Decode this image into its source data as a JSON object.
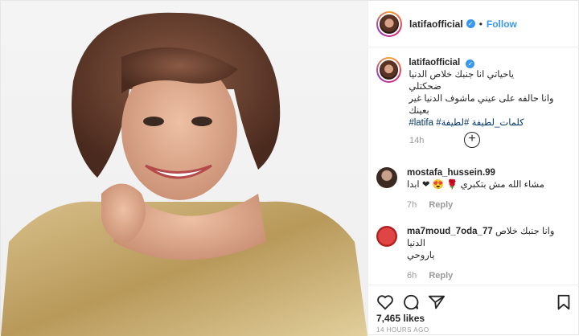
{
  "post": {
    "username": "latifaofficial",
    "follow_label": "Follow",
    "dot": "•",
    "caption_user": "latifaofficial",
    "caption_lines": [
      "ياحياتي انا جنبك خلاص الدنيا",
      "ضحكتلي",
      "وانا حالفه على عيني ماشوف الدنيا غير بعينك"
    ],
    "caption_tags": "#latifa #كلمات_لطيفة #لطيفة",
    "caption_time": "14h",
    "likes": "7,465 likes",
    "posted": "14 HOURS AGO"
  },
  "comments": [
    {
      "user": "mostafa_hussein.99",
      "text": "مشاء الله مش بتكبري 🌹 😍 ❤ ابدا",
      "time": "7h",
      "reply": "Reply"
    },
    {
      "user": "ma7moud_7oda_77",
      "text": "وانا جنبك خلاص الدنيا",
      "text2": "ياروحي",
      "time": "6h",
      "reply": "Reply"
    }
  ],
  "icons": {
    "like": "heart-icon",
    "comment": "comment-icon",
    "share": "share-icon",
    "save": "bookmark-icon",
    "load_more": "plus-circle-icon",
    "verified": "verified-badge-icon"
  },
  "colors": {
    "link": "#3897f0",
    "muted": "#999999",
    "hashtag": "#003569"
  }
}
